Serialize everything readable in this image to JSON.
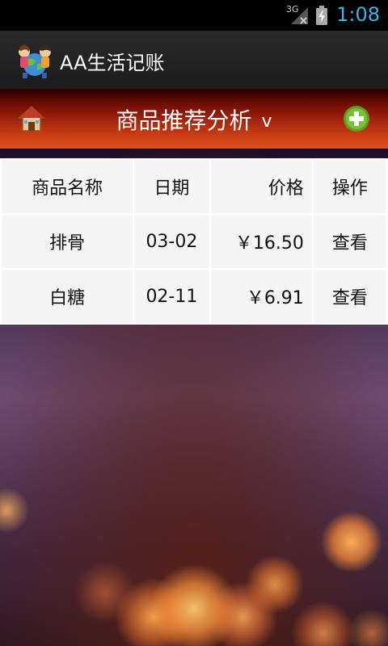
{
  "status_bar": {
    "network": "3G",
    "time": "1:08"
  },
  "action_bar": {
    "title": "AA生活记账"
  },
  "title_bar": {
    "title": "商品推荐分析",
    "chevron": "v"
  },
  "table": {
    "headers": {
      "name": "商品名称",
      "date": "日期",
      "price": "价格",
      "action": "操作"
    },
    "rows": [
      {
        "name": "排骨",
        "date": "03-02",
        "price": "￥16.50",
        "action": "查看"
      },
      {
        "name": "白糖",
        "date": "02-11",
        "price": "￥6.91",
        "action": "查看"
      }
    ]
  },
  "colors": {
    "title_bar_accent": "#e0531d",
    "status_time": "#33b5e5",
    "add_button": "#7ac13a"
  },
  "icons": {
    "app": "kids-globe-app-icon",
    "home": "home-icon",
    "add": "add-circle-icon",
    "network": "signal-icon",
    "battery": "battery-charging-icon"
  }
}
